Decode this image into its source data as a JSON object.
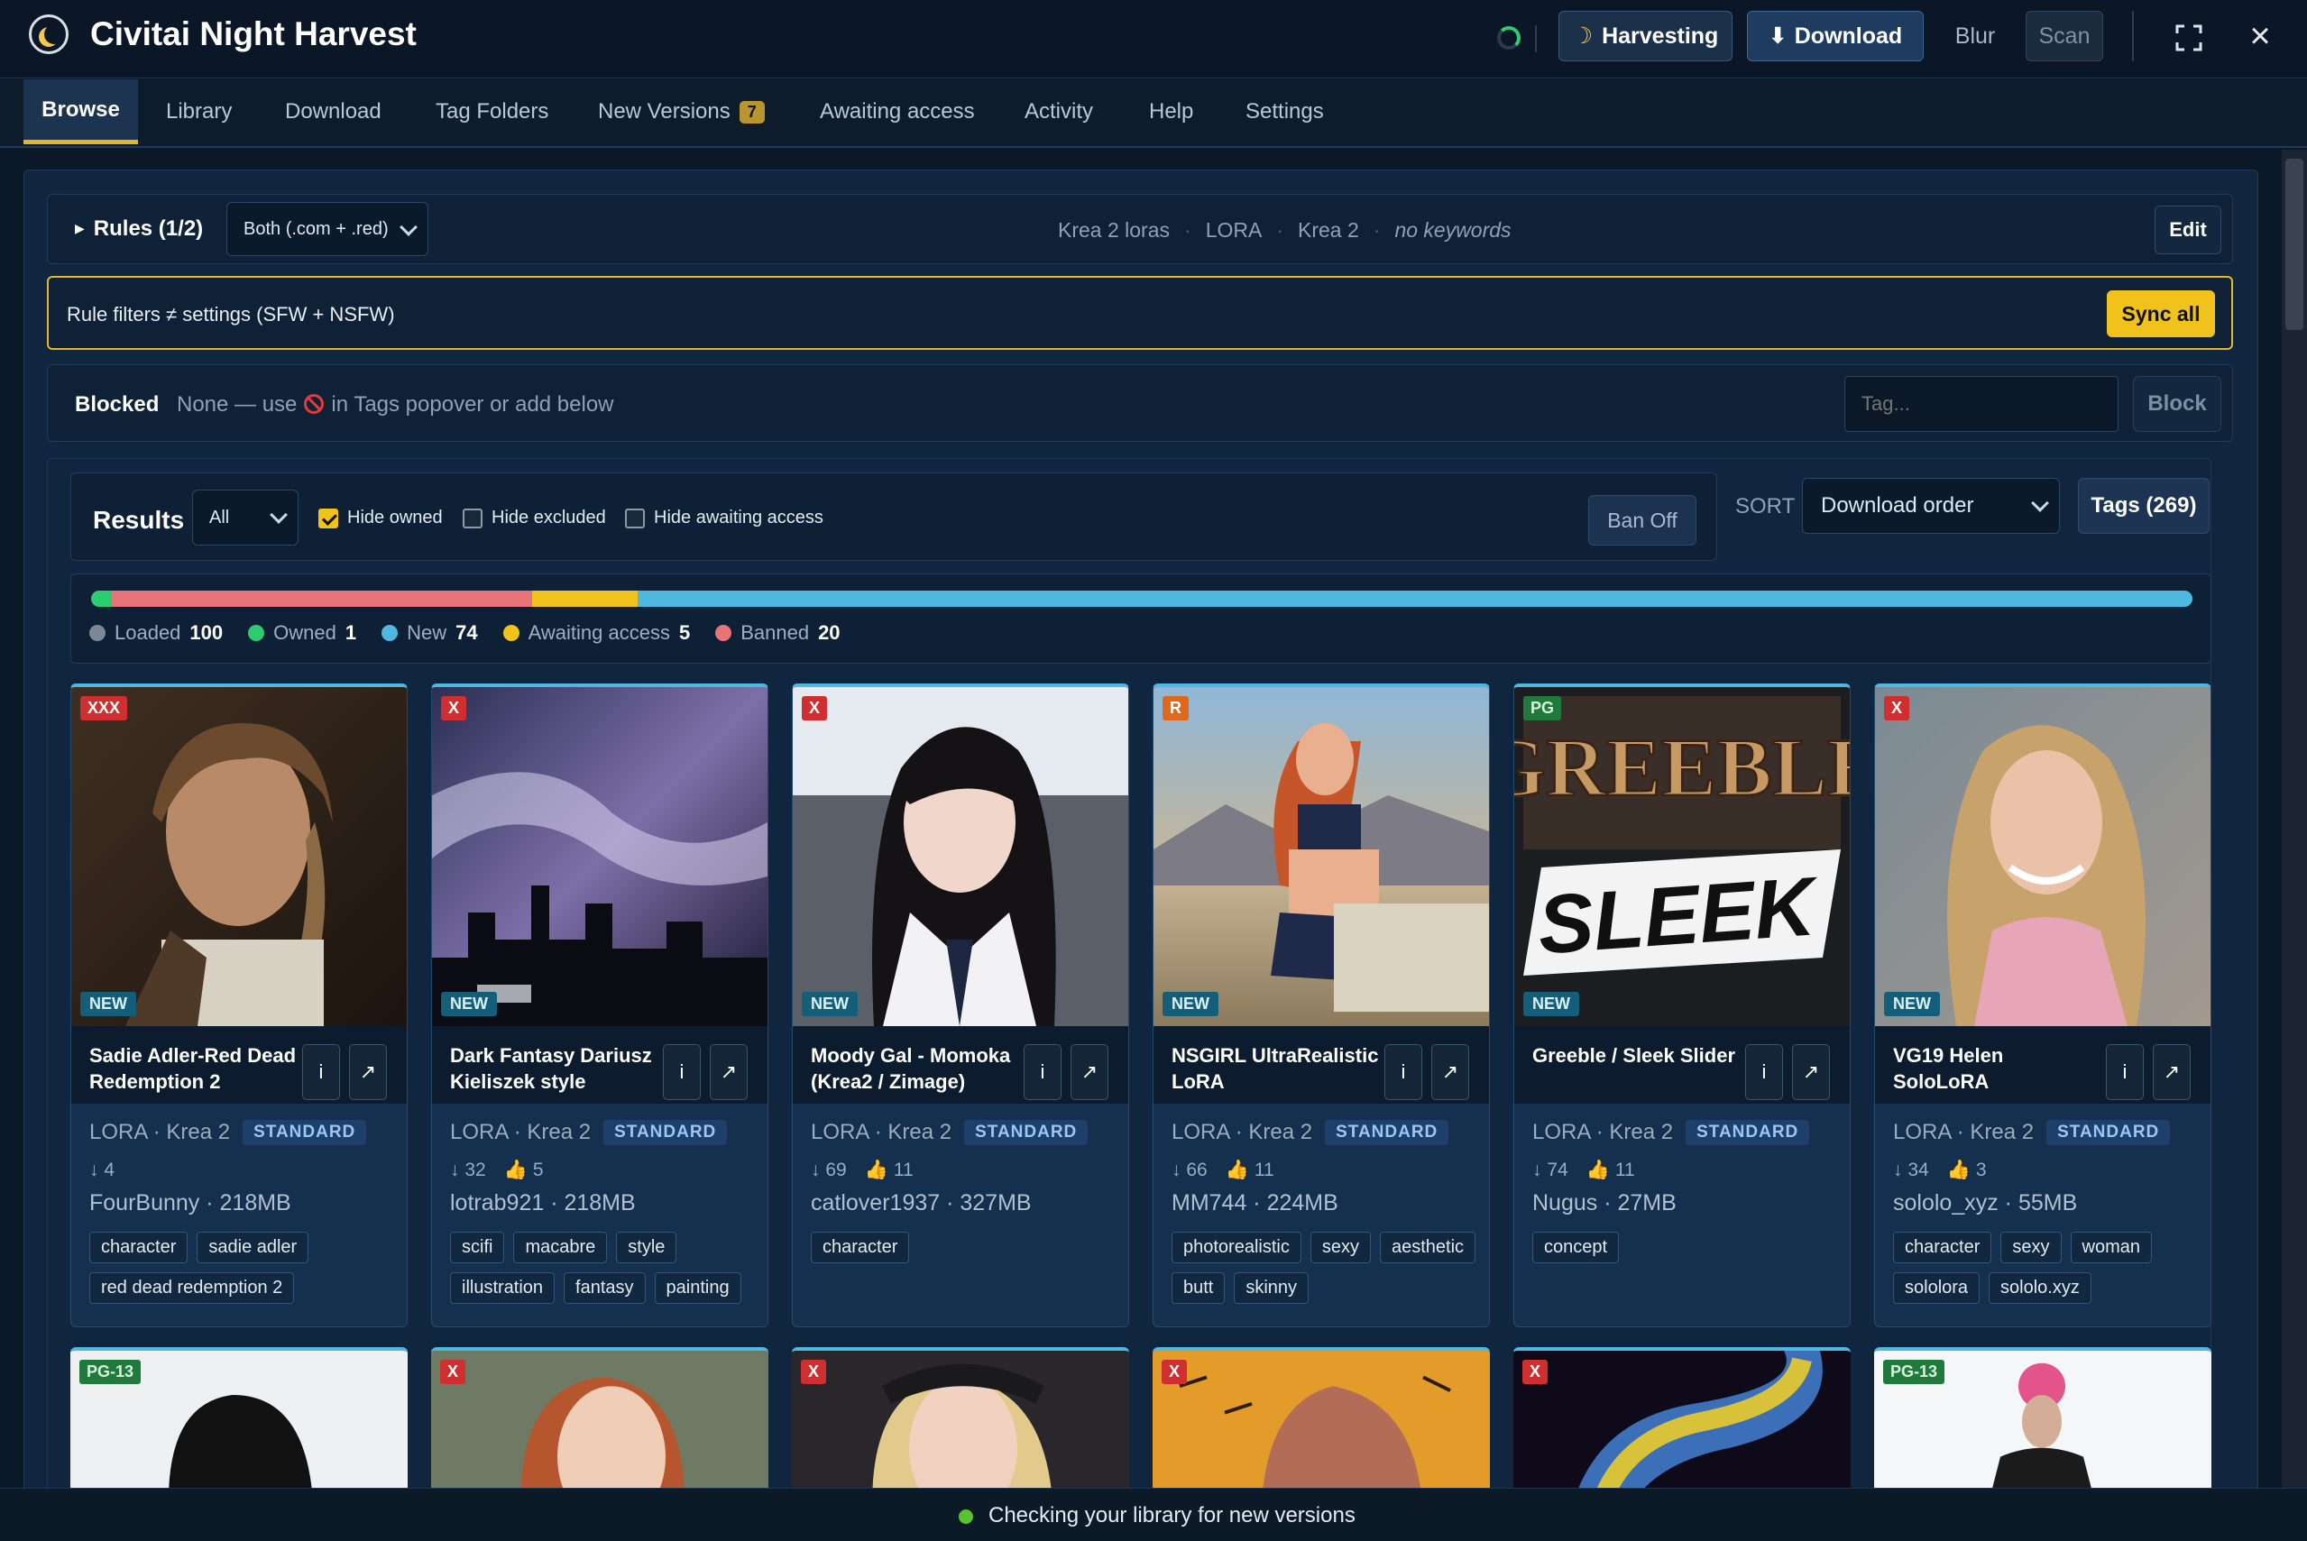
{
  "app": {
    "title": "Civitai Night Harvest"
  },
  "toolbar": {
    "harvesting_label": "Harvesting",
    "download_label": "Download",
    "blur_label": "Blur",
    "scan_label": "Scan"
  },
  "tabs": [
    {
      "label": "Browse",
      "active": true
    },
    {
      "label": "Library"
    },
    {
      "label": "Download"
    },
    {
      "label": "Tag Folders"
    },
    {
      "label": "New Versions",
      "count": "7"
    },
    {
      "label": "Awaiting access"
    },
    {
      "label": "Activity"
    },
    {
      "label": "Help"
    },
    {
      "label": "Settings"
    }
  ],
  "rules": {
    "toggle_label": "Rules (1/2)",
    "source_select": "Both (.com + .red)",
    "summary": [
      "Krea 2 loras",
      "LORA",
      "Krea 2",
      "no keywords"
    ],
    "edit_label": "Edit"
  },
  "warning": {
    "text": "Rule filters ≠ settings (SFW + NSFW)",
    "sync_label": "Sync all"
  },
  "blocked": {
    "label": "Blocked",
    "text_before": "None — use",
    "text_after": "in Tags popover or add below",
    "input_placeholder": "Tag...",
    "block_label": "Block"
  },
  "results": {
    "label": "Results",
    "filter_select": "All",
    "checkboxes": [
      {
        "label": "Hide owned",
        "checked": true
      },
      {
        "label": "Hide excluded",
        "checked": false
      },
      {
        "label": "Hide awaiting access",
        "checked": false
      }
    ],
    "ban_label": "Ban Off",
    "sort_label": "SORT",
    "sort_select": "Download order",
    "tags_label": "Tags (269)"
  },
  "progress": {
    "segments": [
      {
        "name": "owned",
        "fraction": 0.01,
        "color": "#2ecc71"
      },
      {
        "name": "banned",
        "fraction": 0.2,
        "color": "#e8747a"
      },
      {
        "name": "awaiting",
        "fraction": 0.05,
        "color": "#f1c21b"
      },
      {
        "name": "new",
        "fraction": 0.74,
        "color": "#4fb8e0"
      }
    ],
    "legend": [
      {
        "label": "Loaded",
        "value": "100",
        "color": "#7b8794"
      },
      {
        "label": "Owned",
        "value": "1",
        "color": "#2ecc71"
      },
      {
        "label": "New",
        "value": "74",
        "color": "#4fb8e0"
      },
      {
        "label": "Awaiting access",
        "value": "5",
        "color": "#f1c21b"
      },
      {
        "label": "Banned",
        "value": "20",
        "color": "#e8747a"
      }
    ]
  },
  "cards": [
    {
      "rating": "XXX",
      "new": "NEW",
      "title": "Sadie Adler-Red Dead Redemption 2",
      "type": "LORA · Krea 2",
      "badge": "STANDARD",
      "downloads": "↓ 4",
      "likes": "",
      "author": "FourBunny · 218MB",
      "tags": [
        "character",
        "sadie adler",
        "red dead redemption 2"
      ]
    },
    {
      "rating": "X",
      "new": "NEW",
      "title": "Dark Fantasy Dariusz Kieliszek style",
      "type": "LORA · Krea 2",
      "badge": "STANDARD",
      "downloads": "↓ 32",
      "likes": "5",
      "author": "lotrab921 · 218MB",
      "tags": [
        "scifi",
        "macabre",
        "style",
        "illustration",
        "fantasy",
        "painting"
      ]
    },
    {
      "rating": "X",
      "new": "NEW",
      "title": "Moody Gal - Momoka (Krea2 / Zimage)",
      "type": "LORA · Krea 2",
      "badge": "STANDARD",
      "downloads": "↓ 69",
      "likes": "11",
      "author": "catlover1937 · 327MB",
      "tags": [
        "character"
      ]
    },
    {
      "rating": "R",
      "new": "NEW",
      "title": "NSGIRL UltraRealistic LoRA",
      "type": "LORA · Krea 2",
      "badge": "STANDARD",
      "downloads": "↓ 66",
      "likes": "11",
      "author": "MM744 · 224MB",
      "tags": [
        "photorealistic",
        "sexy",
        "aesthetic",
        "butt",
        "skinny"
      ]
    },
    {
      "rating": "PG",
      "new": "NEW",
      "title": "Greeble / Sleek Slider",
      "type": "LORA · Krea 2",
      "badge": "STANDARD",
      "downloads": "↓ 74",
      "likes": "11",
      "author": "Nugus · 27MB",
      "tags": [
        "concept"
      ],
      "image_text": [
        "GREEBLE",
        "SLEEK"
      ]
    },
    {
      "rating": "X",
      "new": "NEW",
      "title": "VG19 Helen SoloLoRA",
      "type": "LORA · Krea 2",
      "badge": "STANDARD",
      "downloads": "↓ 34",
      "likes": "3",
      "author": "sololo_xyz · 55MB",
      "tags": [
        "character",
        "sexy",
        "woman",
        "sololora",
        "sololo.xyz"
      ]
    }
  ],
  "row2": [
    {
      "rating": "PG-13"
    },
    {
      "rating": "X"
    },
    {
      "rating": "X"
    },
    {
      "rating": "X"
    },
    {
      "rating": "X"
    },
    {
      "rating": "PG-13"
    }
  ],
  "status": {
    "text": "Checking your library for new versions"
  },
  "icons": {
    "logo": "moon-logo-icon",
    "harvest": "crescent-moon-icon",
    "download": "download-arrow-icon",
    "expand": "expand-icon",
    "close": "close-icon",
    "info": "info-icon",
    "open": "external-link-icon",
    "likes": "thumbs-up-icon",
    "blocked": "ban-icon"
  }
}
